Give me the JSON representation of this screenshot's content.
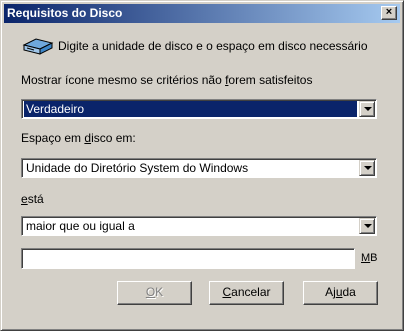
{
  "window": {
    "title": "Requisitos do Disco",
    "close_label": "×"
  },
  "header": {
    "instruction": "Digite a unidade de disco e o espaço em disco necessário",
    "icon": "disk-drive-icon"
  },
  "show_icon": {
    "label_pre": "Mostrar ícone mesmo se critérios não ",
    "label_mnemonic": "f",
    "label_post": "orem satisfeitos",
    "value": "Verdadeiro"
  },
  "disk_space": {
    "label_pre": "Espaço em ",
    "label_mnemonic": "d",
    "label_post": "isco em:",
    "value": "Unidade do Diretório System do Windows"
  },
  "comparison": {
    "label_mnemonic": "e",
    "label_post": "stá",
    "value": "maior que ou igual a"
  },
  "size": {
    "value": "",
    "unit_mnemonic": "M",
    "unit_post": "B"
  },
  "buttons": {
    "ok_mnemonic": "O",
    "ok_post": "K",
    "cancel_mnemonic": "C",
    "cancel_post": "ancelar",
    "help_pre": "Aj",
    "help_mnemonic": "u",
    "help_post": "da"
  }
}
